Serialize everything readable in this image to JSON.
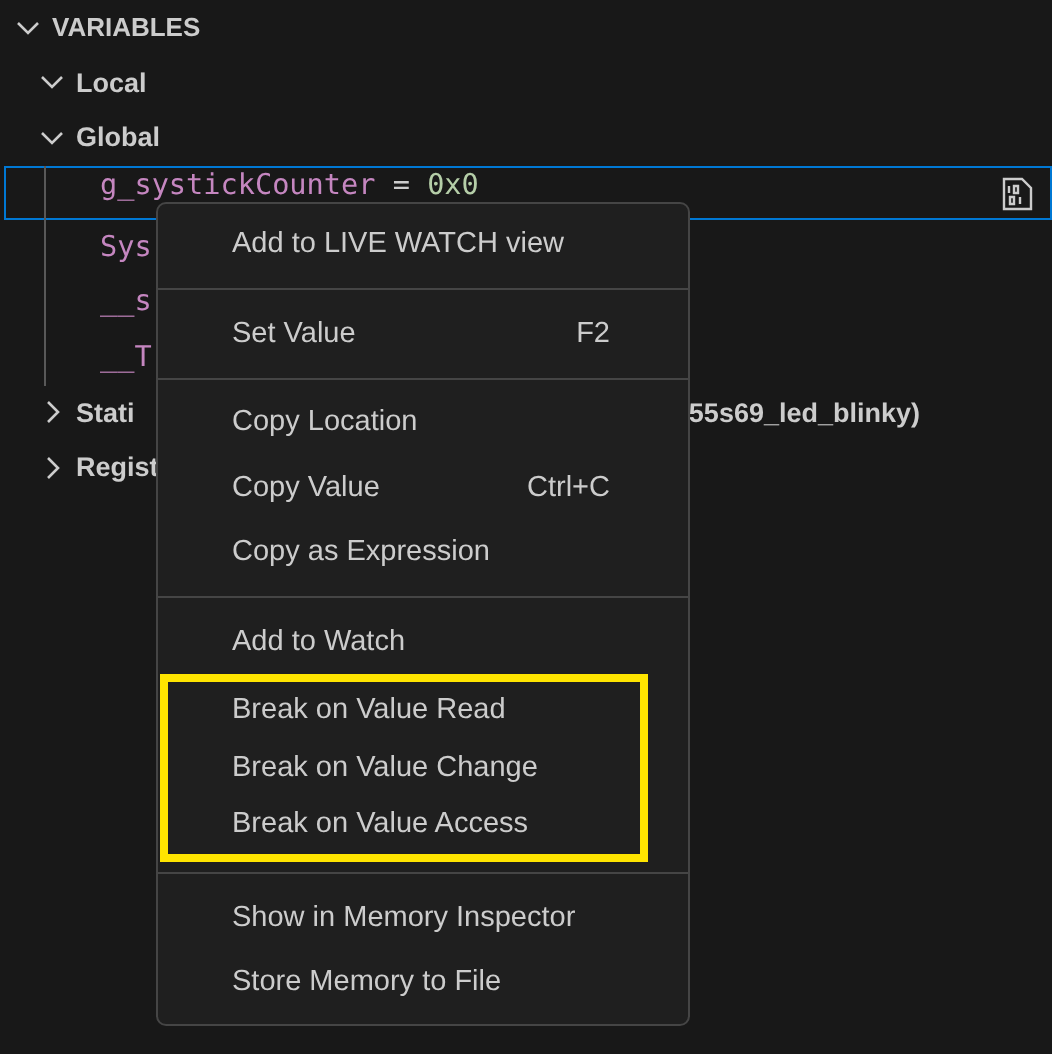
{
  "panel": {
    "title": "VARIABLES",
    "expanded": true,
    "tree": [
      {
        "label": "Local",
        "expanded": true,
        "kind": "scope"
      },
      {
        "label": "Global",
        "expanded": true,
        "kind": "scope",
        "children": [
          {
            "kind": "var",
            "name": "g_systickCounter",
            "operator": "=",
            "value": "0x0",
            "selected": true
          },
          {
            "kind": "var",
            "name": "Sys",
            "selected": false
          },
          {
            "kind": "var",
            "name": "__s",
            "selected": false
          },
          {
            "kind": "var",
            "name": "__T",
            "selected": false
          }
        ]
      },
      {
        "label": "Stati",
        "tail": "55s69_led_blinky)",
        "expanded": false,
        "kind": "scope"
      },
      {
        "label": "Regist",
        "expanded": false,
        "kind": "scope"
      }
    ]
  },
  "context_menu": {
    "groups": [
      [
        {
          "label": "Add to LIVE WATCH view",
          "highlighted": false
        }
      ],
      [
        {
          "label": "Set Value",
          "shortcut": "F2",
          "highlighted": false
        }
      ],
      [
        {
          "label": "Copy Location",
          "highlighted": false
        },
        {
          "label": "Copy Value",
          "shortcut": "Ctrl+C",
          "highlighted": false
        },
        {
          "label": "Copy as Expression",
          "highlighted": false
        }
      ],
      [
        {
          "label": "Add to Watch",
          "highlighted": false
        },
        {
          "label": "Break on Value Read",
          "highlighted": true
        },
        {
          "label": "Break on Value Change",
          "highlighted": true
        },
        {
          "label": "Break on Value Access",
          "highlighted": true
        }
      ],
      [
        {
          "label": "Show in Memory Inspector",
          "highlighted": false
        },
        {
          "label": "Store Memory to File",
          "highlighted": false
        }
      ]
    ]
  }
}
